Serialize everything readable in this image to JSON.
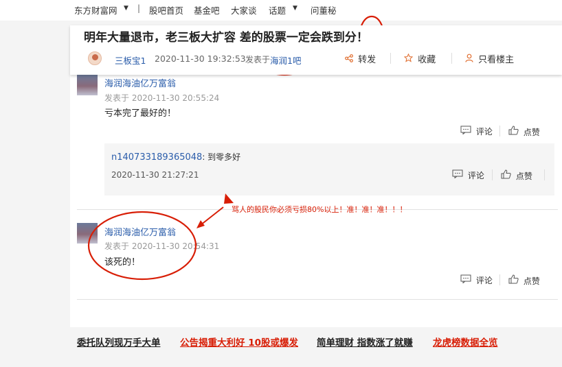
{
  "nav": {
    "items": [
      "东方财富网",
      "股吧首页",
      "基金吧",
      "大家谈",
      "话题",
      "问董秘"
    ],
    "caret": "▼",
    "separator": "|"
  },
  "post": {
    "title": "明年大量退市，老三板大扩容 差的股票一定会跌到分！",
    "author": "三板宝1",
    "time": "2020-11-30 19:32:53",
    "posted_in": "发表于",
    "bar_name": "海润1吧",
    "share_label": "转发",
    "collect_label": "收藏",
    "only_author_label": "只看楼主"
  },
  "comments": [
    {
      "author": "海润海油亿万富翁",
      "time": "发表于 2020-11-30 20:55:24",
      "text": "亏本完了最好的！",
      "comment_label": "评论",
      "like_label": "点赞",
      "reply": {
        "author": "n140733189365048",
        "text": ": 到零多好",
        "time": "2020-11-30 21:27:21",
        "comment_label": "评论",
        "like_label": "点赞"
      }
    },
    {
      "author": "海润海油亿万富翁",
      "time": "发表于 2020-11-30 20:54:31",
      "text": "该死的！",
      "comment_label": "评论",
      "like_label": "点赞"
    }
  ],
  "annotation": {
    "text": "骂人的股民你必须亏损80%以上！准！准！准！！！",
    "color": "#d81e06"
  },
  "bottom_links": [
    {
      "text": "委托队列现万手大单",
      "color": "#222222"
    },
    {
      "text": "公告揭重大利好 10股或爆发",
      "color": "#d81e06"
    },
    {
      "text": "简单理财 指数涨了就赚",
      "color": "#222222"
    },
    {
      "text": "龙虎榜数据全览",
      "color": "#d81e06"
    }
  ],
  "icons": {
    "share": "share-icon",
    "collect": "star-icon",
    "only_author": "person-icon",
    "comment": "comment-icon",
    "like": "thumbs-up-icon"
  }
}
